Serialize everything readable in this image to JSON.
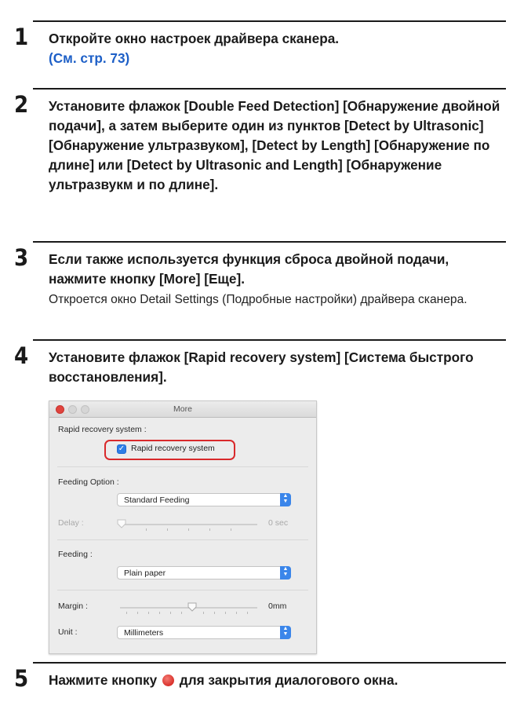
{
  "steps": [
    {
      "number": "1",
      "title": "Откройте окно настроек драйвера сканера.",
      "ref": "(См. стр. 73)"
    },
    {
      "number": "2",
      "title": "Установите флажок [Double Feed Detection] [Обнаружение двойной подачи], а затем выберите один из пунктов [Detect by Ultrasonic] [Обнаружение ультразвуком], [Detect by Length] [Обнаружение по длине] или [Detect by Ultrasonic and Length] [Обнаружение ультразвукм и по длине]."
    },
    {
      "number": "3",
      "title": "Если также используется функция сброса двойной подачи, нажмите кнопку [More] [Еще].",
      "desc": "Откроется окно Detail Settings (Подробные настройки) драйвера сканера."
    },
    {
      "number": "4",
      "title": "Установите флажок [Rapid recovery system] [Система быстрого восстановления]."
    },
    {
      "number": "5",
      "title_before": "Нажмите кнопку",
      "title_after": "для закрытия диалогового окна."
    }
  ],
  "dialog": {
    "title": "More",
    "rapid_label": "Rapid recovery system :",
    "rapid_checkbox_label": "Rapid recovery system",
    "rapid_checked": true,
    "feeding_option_label": "Feeding Option :",
    "feeding_option_value": "Standard Feeding",
    "delay_label": "Delay :",
    "delay_value": "0 sec",
    "feeding_label": "Feeding :",
    "feeding_value": "Plain paper",
    "margin_label": "Margin :",
    "margin_value": "0mm",
    "unit_label": "Unit :",
    "unit_value": "Millimeters",
    "close_color": "#e0443e",
    "highlight_color": "#d9292b",
    "accent_color": "#3b86ea"
  }
}
